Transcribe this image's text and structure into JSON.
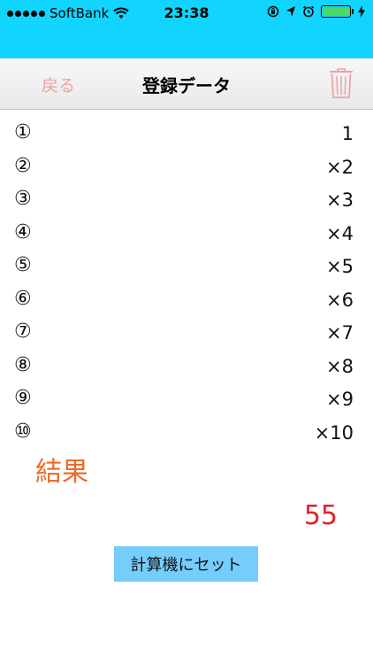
{
  "status_bar": {
    "carrier": "SoftBank",
    "time": "23:38",
    "signal_icon": "signal-dots-icon",
    "wifi_icon": "wifi-icon",
    "battery_level": 1.0,
    "colors": {
      "background": "#11d4ff",
      "battery": "#4cd964"
    }
  },
  "nav": {
    "back_label": "戻る",
    "title": "登録データ",
    "trash_icon": "trash-icon",
    "colors": {
      "back": "#f0a0a4",
      "trash": "#f0a0a4"
    }
  },
  "rows": [
    {
      "num": "①",
      "value": "1"
    },
    {
      "num": "②",
      "value": "×2"
    },
    {
      "num": "③",
      "value": "×3"
    },
    {
      "num": "④",
      "value": "×4"
    },
    {
      "num": "⑤",
      "value": "×5"
    },
    {
      "num": "⑥",
      "value": "×6"
    },
    {
      "num": "⑦",
      "value": "×7"
    },
    {
      "num": "⑧",
      "value": "×8"
    },
    {
      "num": "⑨",
      "value": "×9"
    },
    {
      "num": "⑩",
      "value": "×10"
    }
  ],
  "result": {
    "label": "結果",
    "value": "55",
    "colors": {
      "label": "#ea6a2a",
      "value": "#e0222a"
    }
  },
  "set_button": {
    "label": "計算機にセット",
    "color": "#74cdfb"
  }
}
